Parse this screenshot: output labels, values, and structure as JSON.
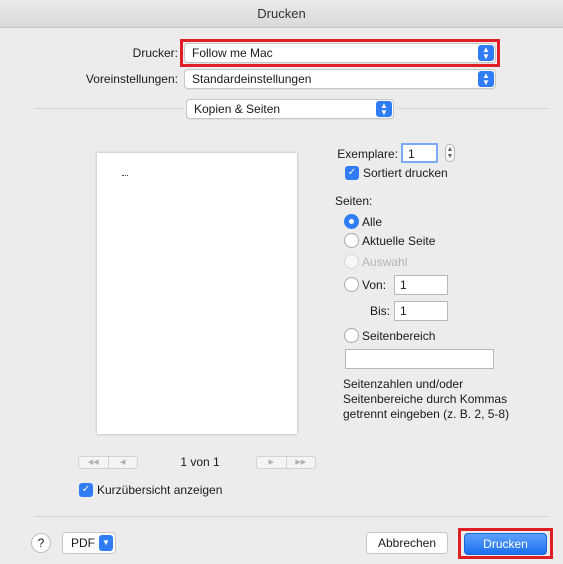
{
  "window": {
    "title": "Drucken"
  },
  "printer": {
    "label": "Drucker:",
    "value": "Follow me Mac"
  },
  "presets": {
    "label": "Voreinstellungen:",
    "value": "Standardeinstellungen"
  },
  "section_popup": {
    "value": "Kopien & Seiten"
  },
  "preview": {
    "page_counter": "1 von 1",
    "first_glyph": "◀◀",
    "prev_glyph": "◀",
    "next_glyph": "▶",
    "last_glyph": "▶▶",
    "thumbnail_label": "Kurzübersicht anzeigen",
    "thumbnail_checked": true
  },
  "copies": {
    "label": "Exemplare:",
    "value": "1",
    "collate_label": "Sortiert drucken",
    "collate_checked": true
  },
  "pages": {
    "label": "Seiten:",
    "all_label": "Alle",
    "current_label": "Aktuelle Seite",
    "selection_label": "Auswahl",
    "from_label": "Von:",
    "from_value": "1",
    "to_label": "Bis:",
    "to_value": "1",
    "range_label": "Seitenbereich",
    "range_value": "",
    "hint": "Seitenzahlen und/oder Seitenbereiche durch Kommas getrennt eingeben (z. B. 2, 5-8)"
  },
  "footer": {
    "help_label": "?",
    "pdf_label": "PDF",
    "cancel_label": "Abbrechen",
    "print_label": "Drucken"
  },
  "colors": {
    "accent": "#2f7cf6",
    "highlight": "#e11d26"
  }
}
